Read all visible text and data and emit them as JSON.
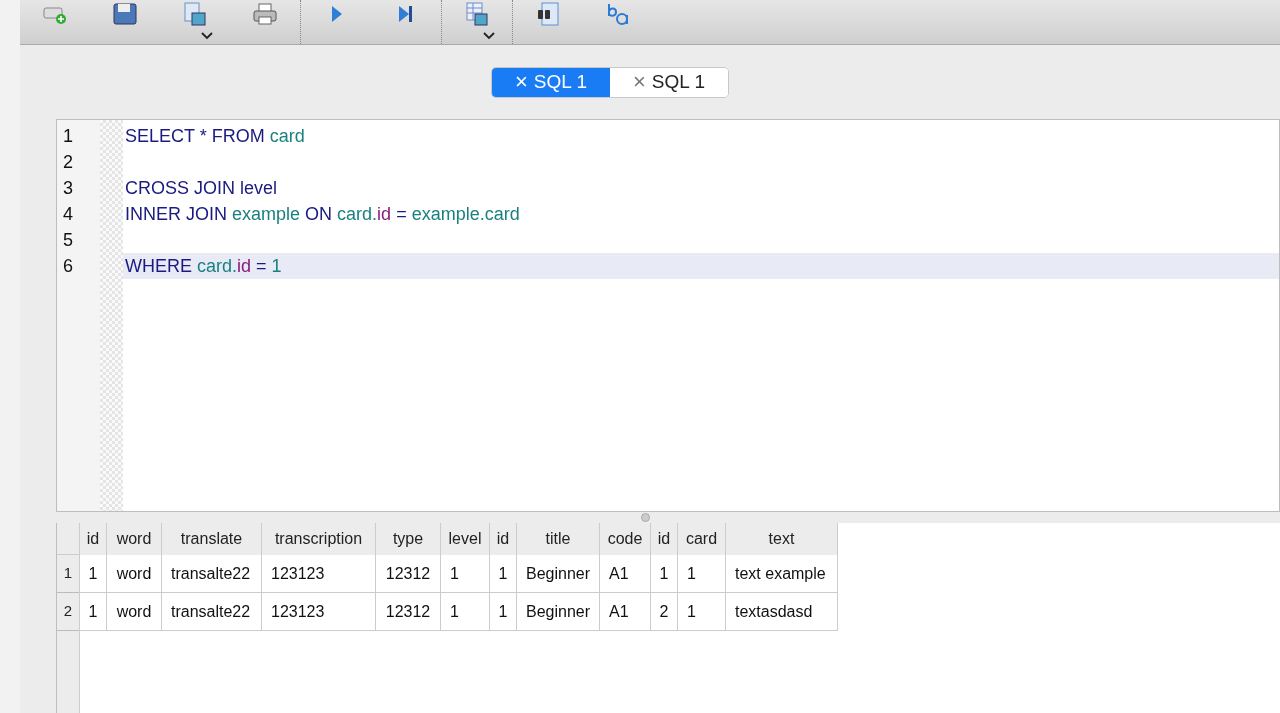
{
  "tabs": [
    {
      "label": "SQL 1",
      "close": "×",
      "selected": true
    },
    {
      "label": "SQL 1",
      "close": "×",
      "selected": false
    }
  ],
  "editor": {
    "lines": [
      {
        "number": "1",
        "current": false,
        "tokens": [
          {
            "kind": "keyword",
            "text": "SELECT * FROM "
          },
          {
            "kind": "ident",
            "text": "card"
          }
        ]
      },
      {
        "number": "2",
        "current": false
      },
      {
        "number": "3",
        "current": false,
        "tokens": [
          {
            "kind": "keyword",
            "text": "CROSS JOIN level"
          }
        ]
      },
      {
        "number": "4",
        "current": false,
        "tokens": [
          {
            "kind": "keyword",
            "text": "INNER JOIN "
          },
          {
            "kind": "ident",
            "text": "example"
          },
          {
            "kind": "keyword",
            "text": " ON "
          },
          {
            "kind": "ident",
            "text": "card."
          },
          {
            "kind": "field",
            "text": "id"
          },
          {
            "kind": "keyword",
            "text": " = "
          },
          {
            "kind": "ident",
            "text": "example.card"
          }
        ]
      },
      {
        "number": "5",
        "current": false
      },
      {
        "number": "6",
        "current": true,
        "tokens": [
          {
            "kind": "keyword",
            "text": "WHERE "
          },
          {
            "kind": "ident",
            "text": "card."
          },
          {
            "kind": "field",
            "text": "id"
          },
          {
            "kind": "keyword",
            "text": " = "
          },
          {
            "kind": "ident",
            "text": "1"
          }
        ]
      }
    ]
  },
  "results": {
    "columns": [
      "id",
      "word",
      "translate",
      "transcription",
      "type",
      "level",
      "id",
      "title",
      "code",
      "id",
      "card",
      "text"
    ],
    "rows": [
      {
        "number": "1",
        "cells": [
          "1",
          "word",
          "transalte22",
          "123123",
          "12312",
          "1",
          "1",
          "Beginner",
          "A1",
          "1",
          "1",
          "text example"
        ]
      },
      {
        "number": "2",
        "cells": [
          "1",
          "word",
          "transalte22",
          "123123",
          "12312",
          "1",
          "1",
          "Beginner",
          "A1",
          "2",
          "1",
          "textasdasd"
        ]
      }
    ]
  }
}
